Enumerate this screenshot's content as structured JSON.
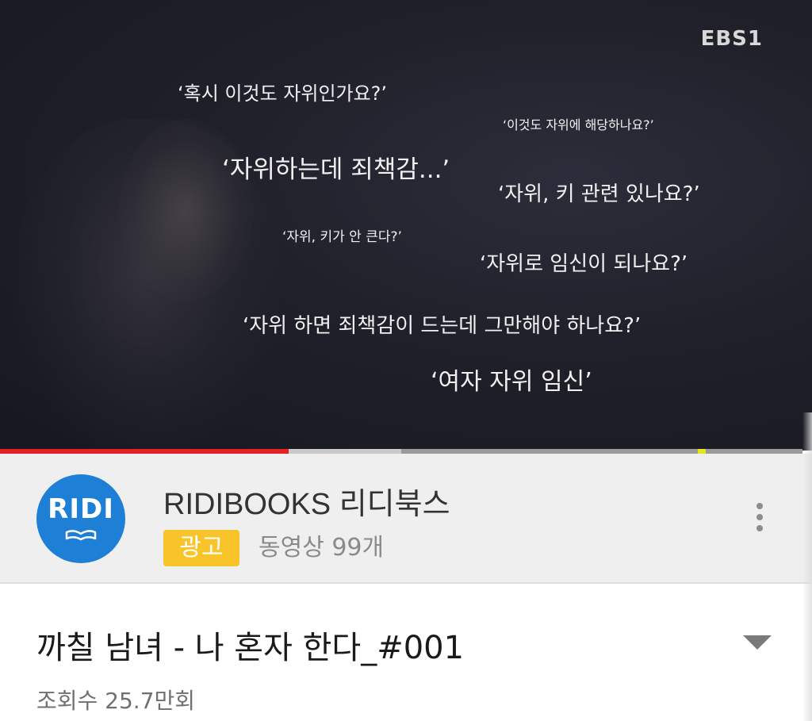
{
  "video": {
    "broadcaster_logo": "EBS1",
    "quotes": [
      "‘혹시 이것도 자위인가요?’",
      "‘이것도 자위에 해당하나요?’",
      "‘자위하는데 죄책감...’",
      "‘자위, 키 관련 있나요?’",
      "‘자위, 키가 안 큰다?’",
      "‘자위로 임신이 되나요?’",
      "‘자위 하면 죄책감이 드는데 그만해야 하나요?’",
      "‘여자 자위 임신’"
    ],
    "progress": {
      "played_fraction": 0.36,
      "buffered_fraction": 0.5,
      "played_color": "#e52020",
      "marker_color": "#e6e61a"
    }
  },
  "channel": {
    "logo_text": "RIDI",
    "logo_color": "#1e7fd6",
    "name": "RIDIBOOKS 리디북스",
    "ad_badge": "광고",
    "ad_badge_color": "#f9c42a",
    "video_count": "동영상 99개",
    "more_icon": "more-vert-icon"
  },
  "details": {
    "title": "까칠 남녀 - 나 혼자 한다_#001",
    "view_count": "조회수 25.7만회",
    "expand_icon": "chevron-down-icon"
  }
}
